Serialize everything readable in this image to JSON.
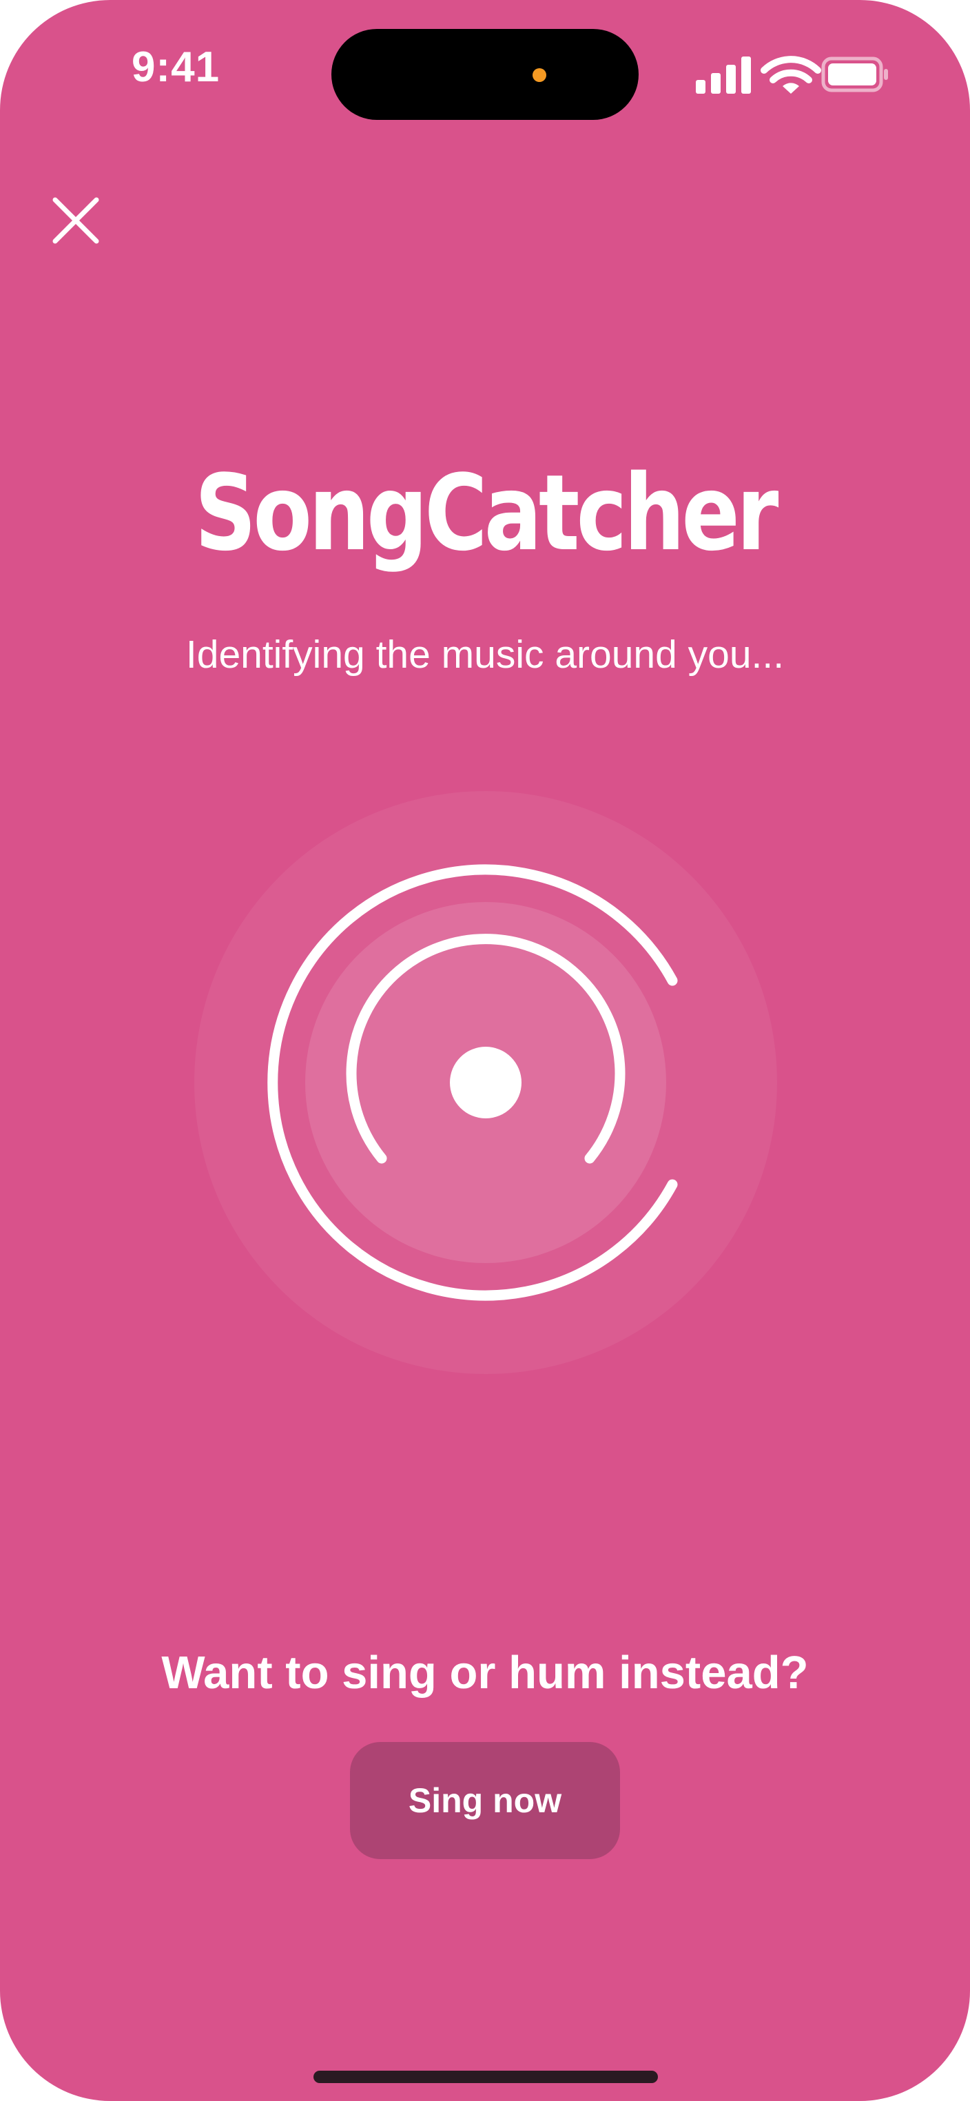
{
  "colors": {
    "background": "#d9528b",
    "button_bg": "#ad4473",
    "island_dot": "#f59a23",
    "text": "#ffffff"
  },
  "status_bar": {
    "time": "9:41",
    "icons": [
      "cellular-signal-icon",
      "wifi-icon",
      "battery-icon"
    ]
  },
  "header": {
    "close_icon": "close-icon"
  },
  "main": {
    "title": "SongCatcher",
    "subtitle": "Identifying the music around you...",
    "listening_icon": "listening-rings-icon"
  },
  "footer": {
    "prompt": "Want to sing or hum instead?",
    "sing_button_label": "Sing now"
  }
}
